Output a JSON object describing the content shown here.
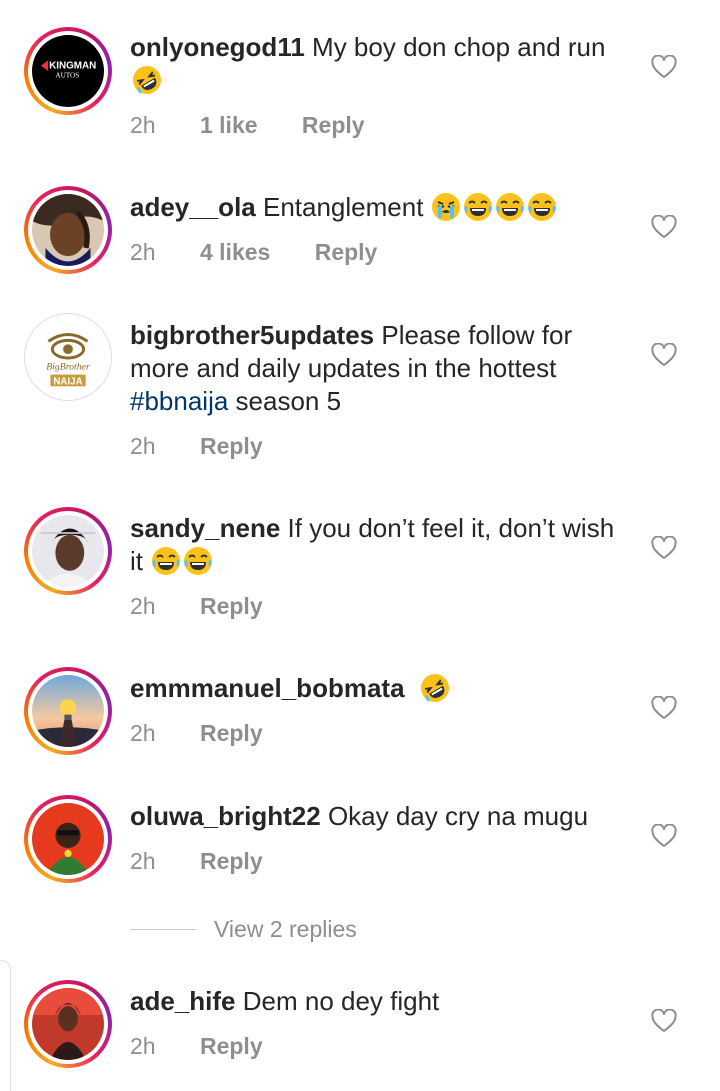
{
  "comments": [
    {
      "username": "onlyonegod11",
      "text": "My boy don chop and run",
      "emojis": [
        "rofl"
      ],
      "time": "2h",
      "likes": "1 like",
      "reply": "Reply"
    },
    {
      "username": "adey__ola",
      "text": "Entanglement",
      "emojis": [
        "weary",
        "joy",
        "joy",
        "joy"
      ],
      "time": "2h",
      "likes": "4 likes",
      "reply": "Reply"
    },
    {
      "username": "bigbrother5updates",
      "text": "Please follow for more and daily updates in the hottest",
      "hashtag": "#bbnaija",
      "text_after": "season 5",
      "time": "2h",
      "reply": "Reply"
    },
    {
      "username": "sandy_nene",
      "text": "If you don’t feel it, don’t wish it",
      "emojis": [
        "joy",
        "joy"
      ],
      "time": "2h",
      "reply": "Reply"
    },
    {
      "username": "emmmanuel_bobmata",
      "text": "",
      "emojis": [
        "rofl"
      ],
      "time": "2h",
      "reply": "Reply"
    },
    {
      "username": "oluwa_bright22",
      "text": "Okay day cry na mugu",
      "time": "2h",
      "reply": "Reply"
    },
    {
      "username": "ade_hife",
      "text": "Dem no dey fight",
      "time": "2h",
      "reply": "Reply"
    }
  ],
  "view_replies": "View 2 replies",
  "avatar_logo": {
    "brand": "KINGMAN",
    "sub": "AUTOS"
  },
  "avatar_bb": {
    "top": "BigBrother",
    "bottom": "NAIJA"
  },
  "colors": {
    "link": "#00376b",
    "muted": "#8e8e8e",
    "text": "#262626"
  }
}
